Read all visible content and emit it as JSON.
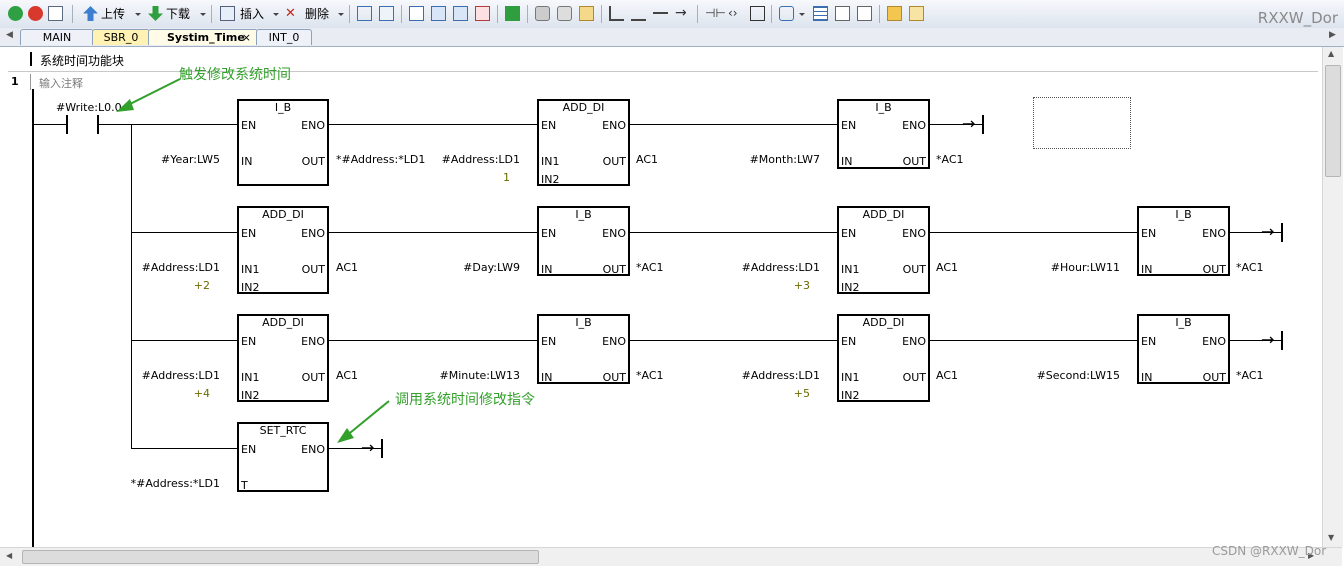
{
  "toolbar": {
    "upload_label": "上传",
    "download_label": "下载",
    "insert_label": "插入",
    "delete_label": "删除",
    "brand": "RXXW_Dor"
  },
  "tabs": [
    "MAIN",
    "SBR_0",
    "Systim_Time",
    "INT_0"
  ],
  "active_tab": "Systim_Time",
  "editor": {
    "block_title": "系统时间功能块",
    "network_number": "1",
    "network_comment": "输入注释",
    "contact_label": "#Write:L0.0"
  },
  "annotations": {
    "trigger": "触发修改系统时间",
    "call": "调用系统时间修改指令"
  },
  "pins": {
    "en": "EN",
    "eno": "ENO",
    "in": "IN",
    "out": "OUT",
    "in1": "IN1",
    "in2": "IN2",
    "t": "T"
  },
  "blocks": {
    "r1b1": {
      "name": "I_B",
      "in": "#Year:LW5",
      "out": "*#Address:*LD1"
    },
    "r1b2": {
      "name": "ADD_DI",
      "in1": "#Address:LD1",
      "in2": "1",
      "out": "AC1"
    },
    "r1b3": {
      "name": "I_B",
      "in": "#Month:LW7",
      "out": "*AC1"
    },
    "r2b1": {
      "name": "ADD_DI",
      "in1": "#Address:LD1",
      "in2": "+2",
      "out": "AC1"
    },
    "r2b2": {
      "name": "I_B",
      "in": "#Day:LW9",
      "out": "*AC1"
    },
    "r2b3": {
      "name": "ADD_DI",
      "in1": "#Address:LD1",
      "in2": "+3",
      "out": "AC1"
    },
    "r2b4": {
      "name": "I_B",
      "in": "#Hour:LW11",
      "out": "*AC1"
    },
    "r3b1": {
      "name": "ADD_DI",
      "in1": "#Address:LD1",
      "in2": "+4",
      "out": "AC1"
    },
    "r3b2": {
      "name": "I_B",
      "in": "#Minute:LW13",
      "out": "*AC1"
    },
    "r3b3": {
      "name": "ADD_DI",
      "in1": "#Address:LD1",
      "in2": "+5",
      "out": "AC1"
    },
    "r3b4": {
      "name": "I_B",
      "in": "#Second:LW15",
      "out": "*AC1"
    },
    "r4b1": {
      "name": "SET_RTC",
      "t": "*#Address:*LD1"
    }
  },
  "watermark": "CSDN @RXXW_Dor",
  "colors": {
    "annotation": "#33a02c",
    "constant": "#6b6b00",
    "active_tab": "#fff2b3"
  }
}
